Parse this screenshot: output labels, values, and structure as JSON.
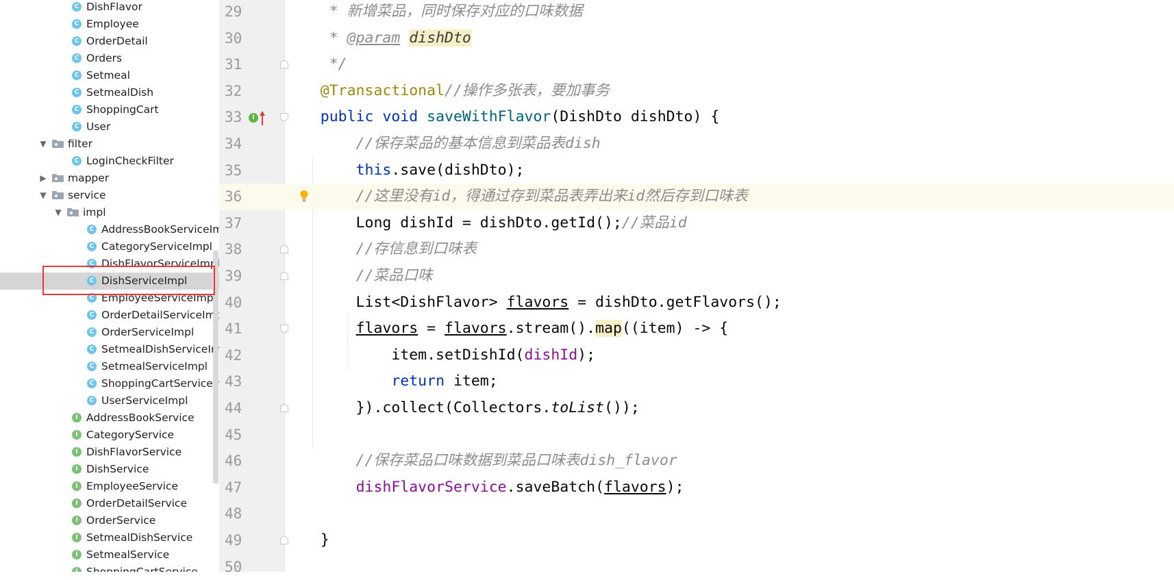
{
  "project_tree": {
    "items": [
      {
        "label": "DishFlavor",
        "kind": "class"
      },
      {
        "label": "Employee",
        "kind": "class"
      },
      {
        "label": "OrderDetail",
        "kind": "class"
      },
      {
        "label": "Orders",
        "kind": "class"
      },
      {
        "label": "Setmeal",
        "kind": "class"
      },
      {
        "label": "SetmealDish",
        "kind": "class"
      },
      {
        "label": "ShoppingCart",
        "kind": "class"
      },
      {
        "label": "User",
        "kind": "class"
      },
      {
        "label": "filter",
        "kind": "package",
        "state": "expanded"
      },
      {
        "label": "LoginCheckFilter",
        "kind": "class"
      },
      {
        "label": "mapper",
        "kind": "package",
        "state": "collapsed"
      },
      {
        "label": "service",
        "kind": "package",
        "state": "expanded"
      },
      {
        "label": "impl",
        "kind": "package",
        "state": "expanded"
      },
      {
        "label": "AddressBookServiceImpl",
        "kind": "class"
      },
      {
        "label": "CategoryServiceImpl",
        "kind": "class"
      },
      {
        "label": "DishFlavorServiceImpl",
        "kind": "class"
      },
      {
        "label": "DishServiceImpl",
        "kind": "class",
        "selected": true
      },
      {
        "label": "EmployeeServiceImpl",
        "kind": "class"
      },
      {
        "label": "OrderDetailServiceImpl",
        "kind": "class"
      },
      {
        "label": "OrderServiceImpl",
        "kind": "class"
      },
      {
        "label": "SetmealDishServiceImpl",
        "kind": "class"
      },
      {
        "label": "SetmealServiceImpl",
        "kind": "class"
      },
      {
        "label": "ShoppingCartServiceImpl",
        "kind": "class"
      },
      {
        "label": "UserServiceImpl",
        "kind": "class"
      },
      {
        "label": "AddressBookService",
        "kind": "interface"
      },
      {
        "label": "CategoryService",
        "kind": "interface"
      },
      {
        "label": "DishFlavorService",
        "kind": "interface"
      },
      {
        "label": "DishService",
        "kind": "interface"
      },
      {
        "label": "EmployeeService",
        "kind": "interface"
      },
      {
        "label": "OrderDetailService",
        "kind": "interface"
      },
      {
        "label": "OrderService",
        "kind": "interface"
      },
      {
        "label": "SetmealDishService",
        "kind": "interface"
      },
      {
        "label": "SetmealService",
        "kind": "interface"
      },
      {
        "label": "ShoppingCartService",
        "kind": "interface"
      }
    ],
    "icon_letters": {
      "class": "C",
      "interface": "I"
    },
    "highlight_color": "#e53935"
  },
  "editor": {
    "current_line": "36",
    "gutter_markers": {
      "implements_icon": "I",
      "implements_arrow": "override-up-arrow-icon",
      "intention": "lightbulb-icon"
    },
    "lines": [
      {
        "num": "29",
        "tokens": [
          {
            "t": "     * 新增菜品，同时保存对应的口味数据",
            "c": "cm"
          }
        ]
      },
      {
        "num": "30",
        "tokens": [
          {
            "t": "     * ",
            "c": "cm"
          },
          {
            "t": "@param",
            "c": "doctag"
          },
          {
            "t": " ",
            "c": "cm"
          },
          {
            "t": "dishDto",
            "c": "docparam"
          }
        ]
      },
      {
        "num": "31",
        "tokens": [
          {
            "t": "     */",
            "c": "cm"
          }
        ]
      },
      {
        "num": "32",
        "tokens": [
          {
            "t": "    ",
            "c": ""
          },
          {
            "t": "@Transactional",
            "c": "ann"
          },
          {
            "t": "//操作多张表，要加事务",
            "c": "cm"
          }
        ]
      },
      {
        "num": "33",
        "tokens": [
          {
            "t": "    ",
            "c": ""
          },
          {
            "t": "public",
            "c": "kw"
          },
          {
            "t": " ",
            "c": ""
          },
          {
            "t": "void",
            "c": "kw"
          },
          {
            "t": " ",
            "c": ""
          },
          {
            "t": "saveWithFlavor",
            "c": "fn"
          },
          {
            "t": "(DishDto dishDto) {",
            "c": ""
          }
        ]
      },
      {
        "num": "34",
        "tokens": [
          {
            "t": "        //保存菜品的基本信息到菜品表dish",
            "c": "cm"
          }
        ]
      },
      {
        "num": "35",
        "tokens": [
          {
            "t": "        ",
            "c": ""
          },
          {
            "t": "this",
            "c": "kw"
          },
          {
            "t": ".save(dishDto);",
            "c": ""
          }
        ]
      },
      {
        "num": "36",
        "tokens": [
          {
            "t": "        //这里没有id，得通过存到菜品表弄出来id然后存到口味表",
            "c": "cm"
          }
        ]
      },
      {
        "num": "37",
        "tokens": [
          {
            "t": "        Long dishId = dishDto.getId();",
            "c": ""
          },
          {
            "t": "//菜品id",
            "c": "cm"
          }
        ]
      },
      {
        "num": "38",
        "tokens": [
          {
            "t": "        //存信息到口味表",
            "c": "cm"
          }
        ]
      },
      {
        "num": "39",
        "tokens": [
          {
            "t": "        //菜品口味",
            "c": "cm"
          }
        ]
      },
      {
        "num": "40",
        "tokens": [
          {
            "t": "        List<DishFlavor> ",
            "c": ""
          },
          {
            "t": "flavors",
            "c": "ul"
          },
          {
            "t": " = dishDto.getFlavors();",
            "c": ""
          }
        ]
      },
      {
        "num": "41",
        "tokens": [
          {
            "t": "        ",
            "c": ""
          },
          {
            "t": "flavors",
            "c": "ul"
          },
          {
            "t": " = ",
            "c": ""
          },
          {
            "t": "flavors",
            "c": "ul"
          },
          {
            "t": ".stream().",
            "c": ""
          },
          {
            "t": "map",
            "c": "hl"
          },
          {
            "t": "((item) -> {",
            "c": ""
          }
        ]
      },
      {
        "num": "42",
        "tokens": [
          {
            "t": "            item.setDishId(",
            "c": ""
          },
          {
            "t": "dishId",
            "c": "fld"
          },
          {
            "t": ");",
            "c": ""
          }
        ]
      },
      {
        "num": "43",
        "tokens": [
          {
            "t": "            ",
            "c": ""
          },
          {
            "t": "return",
            "c": "kw"
          },
          {
            "t": " item;",
            "c": ""
          }
        ]
      },
      {
        "num": "44",
        "tokens": [
          {
            "t": "        }).collect(Collectors.",
            "c": ""
          },
          {
            "t": "toList",
            "c": "it"
          },
          {
            "t": "());",
            "c": ""
          }
        ]
      },
      {
        "num": "45",
        "tokens": []
      },
      {
        "num": "46",
        "tokens": [
          {
            "t": "        //保存菜品口味数据到菜品口味表dish_flavor",
            "c": "cm"
          }
        ]
      },
      {
        "num": "47",
        "tokens": [
          {
            "t": "        ",
            "c": ""
          },
          {
            "t": "dishFlavorService",
            "c": "fld"
          },
          {
            "t": ".saveBatch(",
            "c": ""
          },
          {
            "t": "flavors",
            "c": "ul"
          },
          {
            "t": ");",
            "c": ""
          }
        ]
      },
      {
        "num": "48",
        "tokens": []
      },
      {
        "num": "49",
        "tokens": [
          {
            "t": "    }",
            "c": ""
          }
        ]
      },
      {
        "num": "50",
        "tokens": []
      }
    ]
  }
}
